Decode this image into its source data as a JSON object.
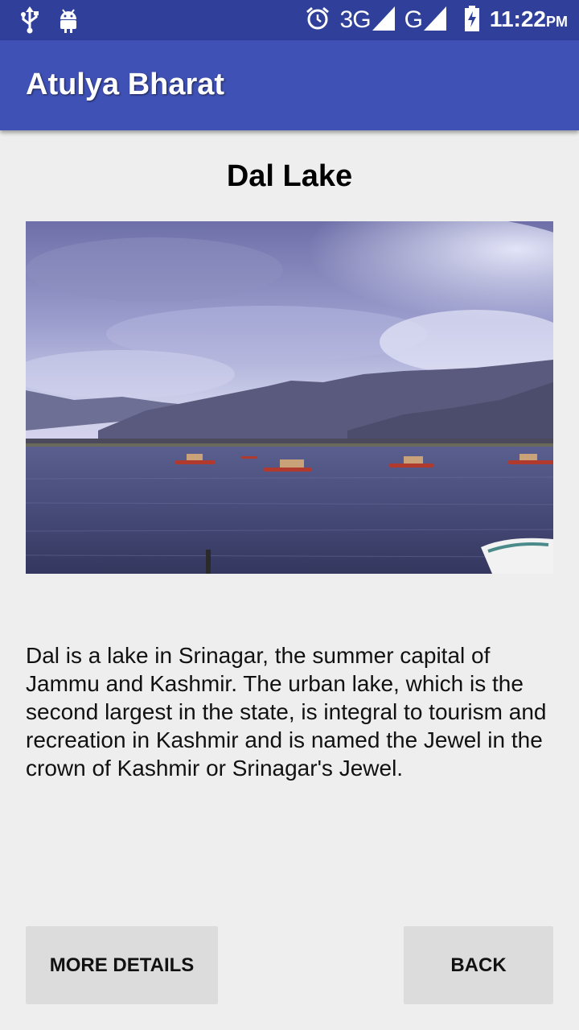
{
  "status_bar": {
    "icons_left": [
      "usb-icon",
      "android-icon"
    ],
    "icons_right": [
      "alarm-icon",
      "signal-icon",
      "battery-charging-icon"
    ],
    "network_1": "3G",
    "network_2": "G",
    "time": "11:22",
    "ampm": "PM"
  },
  "app_bar": {
    "title": "Atulya Bharat"
  },
  "place": {
    "title": "Dal Lake",
    "description": "Dal is a lake in Srinagar, the summer capital of Jammu and Kashmir. The urban lake, which is the second largest in the state, is integral to tourism and recreation in Kashmir and is named the Jewel in the crown of Kashmir or Srinagar's Jewel."
  },
  "buttons": {
    "more_details": "MORE DETAILS",
    "back": "BACK"
  },
  "colors": {
    "status_bar": "#2f3f9a",
    "app_bar": "#3f51b5",
    "background": "#eeeeee",
    "button": "#dcdcdc"
  }
}
